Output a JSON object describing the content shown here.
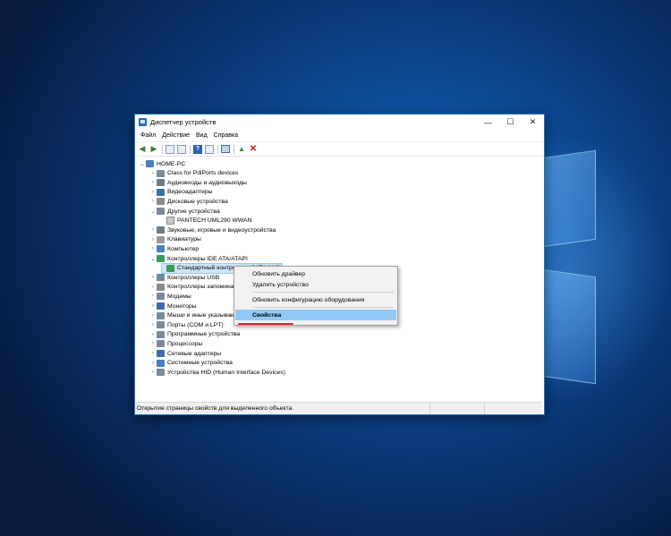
{
  "window": {
    "title": "Диспетчер устройств",
    "controls": {
      "minimize": "—",
      "maximize": "☐",
      "close": "✕"
    }
  },
  "menu": [
    "Файл",
    "Действие",
    "Вид",
    "Справка"
  ],
  "toolbar": {
    "icons": [
      "back-arrow-icon",
      "forward-arrow-icon",
      "properties-icon",
      "list-icon",
      "help-icon",
      "view-icon",
      "monitor-icon",
      "update-driver-icon",
      "uninstall-icon"
    ]
  },
  "tree": {
    "root": "HOME-PC",
    "items": [
      {
        "label": "Class for PdiPorts devices",
        "icon": "dev",
        "expanded": false
      },
      {
        "label": "Аудиовходы и аудиовыходы",
        "icon": "audio",
        "expanded": false
      },
      {
        "label": "Видеоадаптеры",
        "icon": "video",
        "expanded": false
      },
      {
        "label": "Дисковые устройства",
        "icon": "disk",
        "expanded": false
      },
      {
        "label": "Другие устройства",
        "icon": "dev",
        "expanded": true
      },
      {
        "label": "PANTECH UML290 WWAN",
        "icon": "warn",
        "child": true
      },
      {
        "label": "Звуковые, игровые и видеоустройства",
        "icon": "audio",
        "expanded": false
      },
      {
        "label": "Клавиатуры",
        "icon": "kbd",
        "expanded": false
      },
      {
        "label": "Компьютер",
        "icon": "pc",
        "expanded": false
      },
      {
        "label": "Контроллеры IDE ATA/ATAPI",
        "icon": "ide",
        "expanded": true
      },
      {
        "label": "Стандартный контроллер SATA AHCI",
        "icon": "ide",
        "child": true,
        "selected": true
      },
      {
        "label": "Контроллеры USB",
        "icon": "usb",
        "expanded": false
      },
      {
        "label": "Контроллеры запоминающих устройств",
        "icon": "disk",
        "expanded": false
      },
      {
        "label": "Модемы",
        "icon": "dev",
        "expanded": false
      },
      {
        "label": "Мониторы",
        "icon": "video",
        "expanded": false
      },
      {
        "label": "Мыши и иные указывающие устройства",
        "icon": "dev",
        "expanded": false
      },
      {
        "label": "Порты (COM и LPT)",
        "icon": "dev",
        "expanded": false
      },
      {
        "label": "Программные устройства",
        "icon": "dev",
        "expanded": false
      },
      {
        "label": "Процессоры",
        "icon": "dev",
        "expanded": false
      },
      {
        "label": "Сетевые адаптеры",
        "icon": "video",
        "expanded": false
      },
      {
        "label": "Системные устройства",
        "icon": "pc",
        "expanded": false
      },
      {
        "label": "Устройства HID (Human Interface Devices)",
        "icon": "dev",
        "expanded": false
      }
    ]
  },
  "context_menu": {
    "items": [
      "Обновить драйвер",
      "Удалить устройство",
      "Обновить конфигурацию оборудования",
      "Свойства"
    ],
    "highlighted": "Свойства"
  },
  "status": {
    "text": "Открытие страницы свойств для выделенного объекта."
  }
}
